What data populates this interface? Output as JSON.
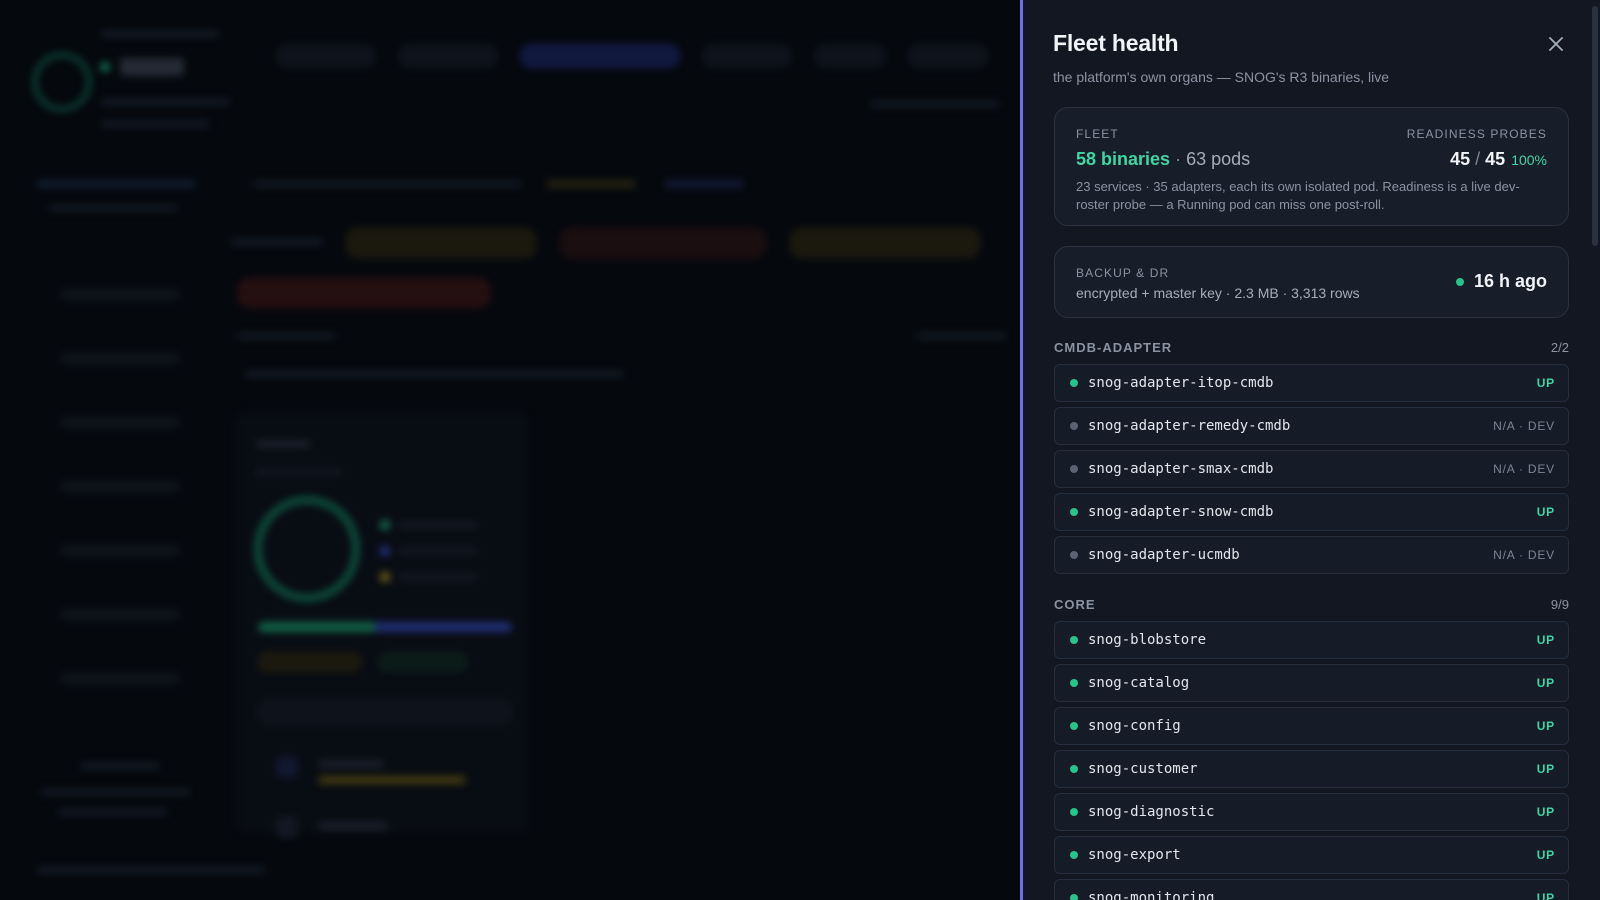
{
  "panel": {
    "title": "Fleet health",
    "subtitle": "the platform's own organs — SNOG's R3 binaries, live",
    "close_icon": "close-icon"
  },
  "fleet": {
    "caption": "FLEET",
    "binaries": "58 binaries",
    "separator": " · ",
    "pods": "63 pods",
    "probes_caption": "READINESS PROBES",
    "probes_ready": "45",
    "probes_slash": " / ",
    "probes_total": "45",
    "probes_pct": "100%",
    "note": "23 services · 35 adapters, each its own isolated pod. Readiness is a live dev-roster probe — a Running pod can miss one post-roll."
  },
  "backup": {
    "caption": "BACKUP & DR",
    "detail": "encrypted + master key · 2.3 MB · 3,313 rows",
    "age": "16 h ago",
    "status_color": "#26c48a"
  },
  "sections": [
    {
      "name": "CMDB-ADAPTER",
      "count": "2/2",
      "services": [
        {
          "name": "snog-adapter-itop-cmdb",
          "state": "UP",
          "ok": true
        },
        {
          "name": "snog-adapter-remedy-cmdb",
          "state": "N/A · DEV",
          "ok": false
        },
        {
          "name": "snog-adapter-smax-cmdb",
          "state": "N/A · DEV",
          "ok": false
        },
        {
          "name": "snog-adapter-snow-cmdb",
          "state": "UP",
          "ok": true
        },
        {
          "name": "snog-adapter-ucmdb",
          "state": "N/A · DEV",
          "ok": false
        }
      ]
    },
    {
      "name": "CORE",
      "count": "9/9",
      "services": [
        {
          "name": "snog-blobstore",
          "state": "UP",
          "ok": true
        },
        {
          "name": "snog-catalog",
          "state": "UP",
          "ok": true
        },
        {
          "name": "snog-config",
          "state": "UP",
          "ok": true
        },
        {
          "name": "snog-customer",
          "state": "UP",
          "ok": true
        },
        {
          "name": "snog-diagnostic",
          "state": "UP",
          "ok": true
        },
        {
          "name": "snog-export",
          "state": "UP",
          "ok": true
        },
        {
          "name": "snog-monitoring",
          "state": "UP",
          "ok": true
        }
      ]
    }
  ],
  "colors": {
    "accent": "#6b72e6",
    "up": "#3ed6a2",
    "down": "#5b6272"
  }
}
